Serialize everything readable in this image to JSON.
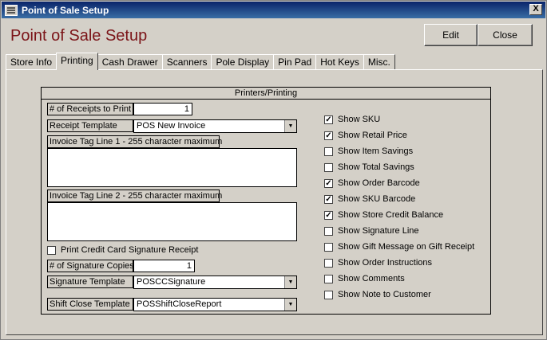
{
  "window": {
    "title": "Point of Sale Setup",
    "close_glyph": "X"
  },
  "heading": "Point of Sale Setup",
  "buttons": {
    "edit": "Edit",
    "close": "Close"
  },
  "tabs": [
    {
      "label": "Store Info"
    },
    {
      "label": "Printing",
      "active": true
    },
    {
      "label": "Cash Drawer"
    },
    {
      "label": "Scanners"
    },
    {
      "label": "Pole Display"
    },
    {
      "label": "Pin Pad"
    },
    {
      "label": "Hot Keys"
    },
    {
      "label": "Misc."
    }
  ],
  "group": {
    "title": "Printers/Printing"
  },
  "fields": {
    "receipts_label": "# of Receipts to Print",
    "receipts_value": "1",
    "receipt_template_label": "Receipt Template",
    "receipt_template_value": "POS New Invoice",
    "tag1_label": "Invoice Tag Line 1 - 255 character maximum",
    "tag1_value": "",
    "tag2_label": "Invoice Tag Line 2 - 255 character maximum",
    "tag2_value": "",
    "print_sig_label": "Print Credit Card Signature Receipt",
    "print_sig_checked": false,
    "sig_copies_label": "# of Signature Copies",
    "sig_copies_value": "1",
    "sig_template_label": "Signature Template",
    "sig_template_value": "POSCCSignature",
    "shift_template_label": "Shift Close Template",
    "shift_template_value": "POSShiftCloseReport"
  },
  "checkboxes": [
    {
      "label": "Show SKU",
      "checked": true
    },
    {
      "label": "Show Retail Price",
      "checked": true
    },
    {
      "label": "Show Item Savings",
      "checked": false
    },
    {
      "label": "Show Total Savings",
      "checked": false
    },
    {
      "label": "Show Order Barcode",
      "checked": true
    },
    {
      "label": "Show SKU Barcode",
      "checked": true
    },
    {
      "label": "Show Store Credit Balance",
      "checked": true
    },
    {
      "label": "Show Signature Line",
      "checked": false
    },
    {
      "label": "Show Gift Message on Gift Receipt",
      "checked": false
    },
    {
      "label": "Show Order Instructions",
      "checked": false
    },
    {
      "label": "Show Comments",
      "checked": false
    },
    {
      "label": "Show Note to Customer",
      "checked": false
    }
  ]
}
